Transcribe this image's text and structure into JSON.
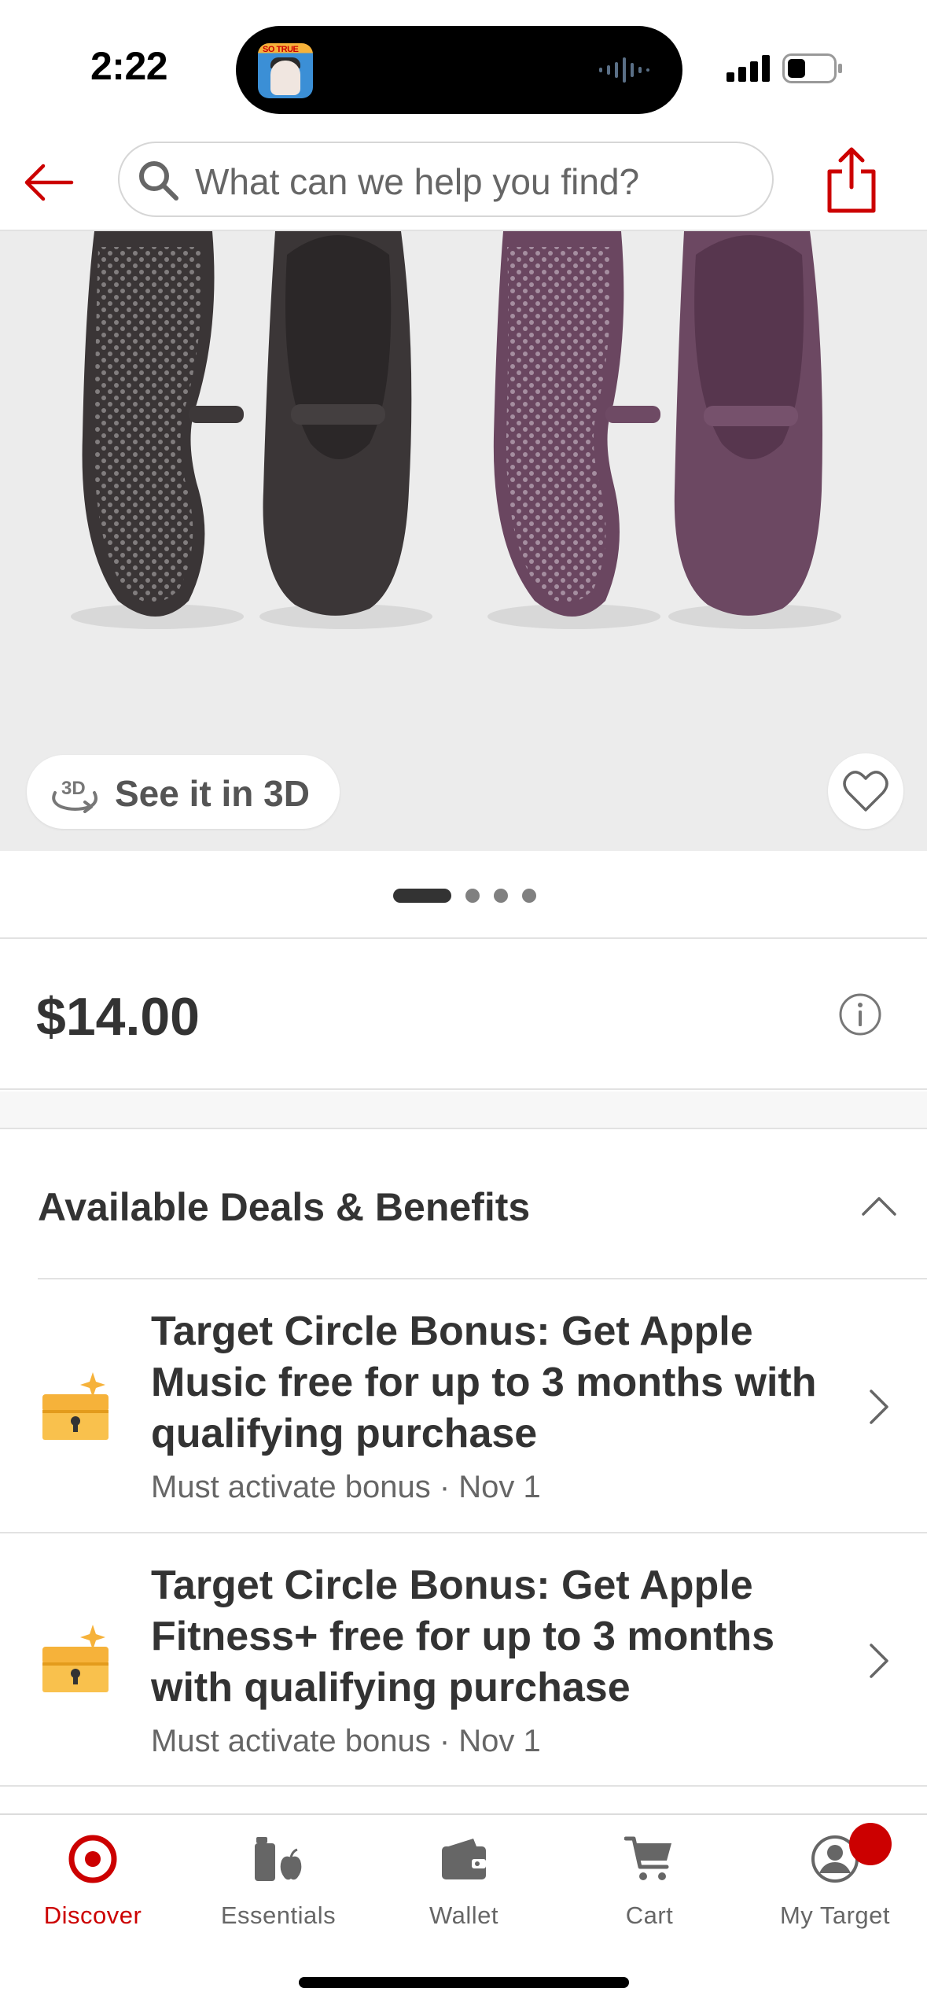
{
  "status_bar": {
    "time": "2:22",
    "island_app_tag": "SO TRUE",
    "icons": [
      "audio-wave-icon",
      "cellular-signal-icon",
      "battery-icon"
    ]
  },
  "topnav": {
    "back_icon": "back-arrow-icon",
    "search_placeholder": "What can we help you find?",
    "share_icon": "share-icon"
  },
  "hero": {
    "see_3d_label": "See it in 3D",
    "icon_3d": "3D",
    "favorite_icon": "heart-icon"
  },
  "pager": {
    "count": 4,
    "active_index": 0
  },
  "price": {
    "value": "$14.00",
    "info_icon": "info-icon"
  },
  "deals": {
    "title": "Available Deals & Benefits",
    "items": [
      {
        "title": "Target Circle Bonus: Get Apple Music free for up to 3 months with qualifying purchase",
        "subtitle": "Must activate bonus · Nov 1"
      },
      {
        "title": "Target Circle Bonus: Get Apple Fitness+ free for up to 3 months with qualifying purchase",
        "subtitle": "Must activate bonus · Nov 1"
      }
    ]
  },
  "tabbar": {
    "tabs": [
      {
        "label": "Discover",
        "icon": "target-logo-icon",
        "active": true
      },
      {
        "label": "Essentials",
        "icon": "essentials-icon",
        "active": false
      },
      {
        "label": "Wallet",
        "icon": "wallet-icon",
        "active": false
      },
      {
        "label": "Cart",
        "icon": "cart-icon",
        "active": false
      },
      {
        "label": "My Target",
        "icon": "account-icon",
        "active": false
      }
    ]
  },
  "colors": {
    "brand_red": "#cc0000",
    "text_dark": "#333333",
    "text_muted": "#666666"
  }
}
